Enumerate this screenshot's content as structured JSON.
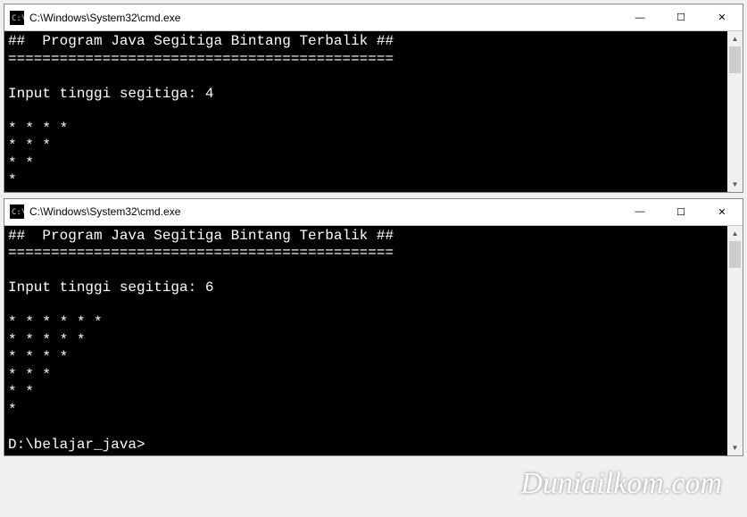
{
  "window1": {
    "title": "C:\\Windows\\System32\\cmd.exe",
    "lines": [
      "##  Program Java Segitiga Bintang Terbalik ##",
      "=============================================",
      "",
      "Input tinggi segitiga: 4",
      "",
      "* * * *",
      "* * *",
      "* *",
      "*"
    ]
  },
  "window2": {
    "title": "C:\\Windows\\System32\\cmd.exe",
    "lines": [
      "##  Program Java Segitiga Bintang Terbalik ##",
      "=============================================",
      "",
      "Input tinggi segitiga: 6",
      "",
      "* * * * * *",
      "* * * * *",
      "* * * *",
      "* * *",
      "* *",
      "*",
      "",
      "D:\\belajar_java>"
    ]
  },
  "controls": {
    "minimize": "—",
    "maximize": "☐",
    "close": "✕"
  },
  "watermark": "Duniailkom.com"
}
